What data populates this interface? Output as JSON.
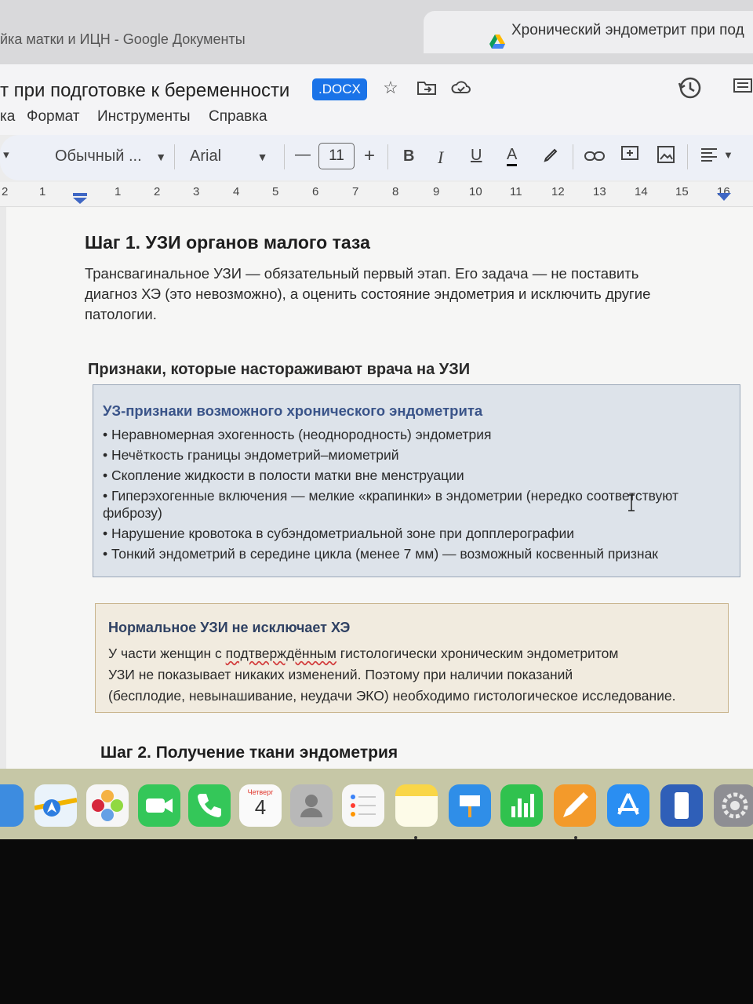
{
  "browser": {
    "tab_left": "йка матки и ИЦН - Google Документы",
    "tab_right": "Хронический эндометрит при под"
  },
  "docs": {
    "title": "т при подготовке к беременности",
    "badge": ".DOCX",
    "menu": [
      "ка",
      "Формат",
      "Инструменты",
      "Справка"
    ],
    "toolbar": {
      "style": "Обычный ...",
      "font": "Arial",
      "size": "11",
      "bold": "B",
      "italic": "I",
      "underline": "U",
      "text_color": "A"
    },
    "ruler": [
      "2",
      "1",
      "1",
      "2",
      "3",
      "4",
      "5",
      "6",
      "7",
      "8",
      "9",
      "10",
      "11",
      "12",
      "13",
      "14",
      "15",
      "16"
    ]
  },
  "document": {
    "heading1": "Шаг 1. УЗИ органов малого таза",
    "para1_lines": [
      "Трансвагинальное УЗИ — обязательный первый этап. Его задача — не поставить",
      "диагноз ХЭ (это невозможно), а оценить состояние эндометрия и исключить другие",
      "патологии."
    ],
    "heading2": "Признаки, которые настораживают врача на УЗИ",
    "blue_box": {
      "title": "УЗ-признаки возможного хронического эндометрита",
      "items": [
        "• Неравномерная эхогенность (неоднородность) эндометрия",
        "• Нечёткость границы эндометрий–миометрий",
        "• Скопление жидкости в полости матки вне менструации",
        "• Гиперэхогенные включения — мелкие «крапинки» в эндометрии (нередко соответствуют фиброзу)",
        "• Нарушение кровотока в субэндометриальной зоне при допплерографии",
        "• Тонкий эндометрий в середине цикла (менее 7 мм) — возможный косвенный признак"
      ]
    },
    "tan_box": {
      "title": "Нормальное УЗИ не исключает ХЭ",
      "line1_a": "У части женщин с ",
      "line1_b": "подтверждённым",
      "line1_c": " гистологически хроническим эндометритом",
      "line2": "УЗИ не показывает никаких изменений. Поэтому при наличии показаний",
      "line3": "(бесплодие, невынашивание, неудачи ЭКО) необходимо гистологическое исследование."
    },
    "heading3": "Шаг 2. Получение ткани эндометрия"
  },
  "dock": {
    "calendar_day": "Четверг",
    "calendar_date": "4"
  },
  "colors": {
    "accent": "#1a73e8",
    "blue_box_bg": "#dde3ea",
    "blue_box_title": "#3a5489",
    "tan_box_bg": "#f1ebdf"
  }
}
